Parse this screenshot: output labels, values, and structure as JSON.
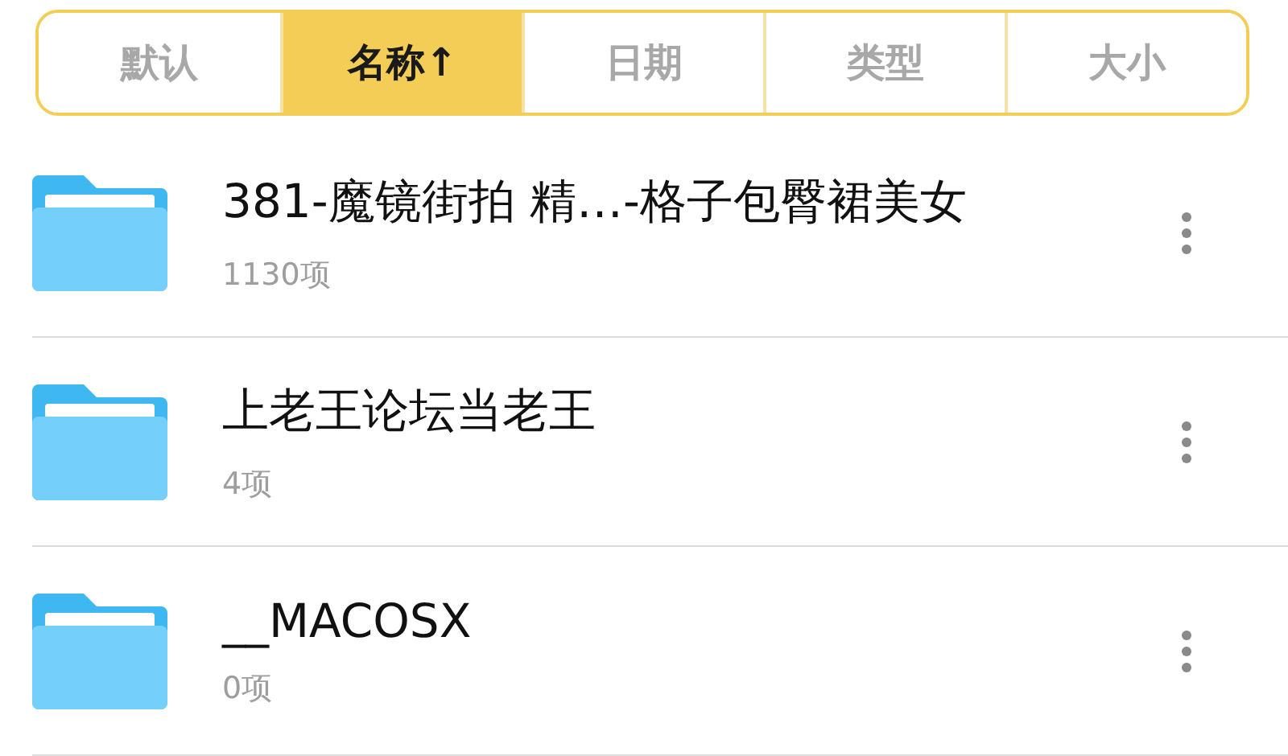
{
  "sort_tabs": [
    {
      "label": "默认",
      "selected": false
    },
    {
      "label": "名称↑",
      "selected": true
    },
    {
      "label": "日期",
      "selected": false
    },
    {
      "label": "类型",
      "selected": false
    },
    {
      "label": "大小",
      "selected": false
    }
  ],
  "files": [
    {
      "name": "381-魔镜街拍 精…-格子包臀裙美女",
      "count": "1130项"
    },
    {
      "name": "上老王论坛当老王",
      "count": "4项"
    },
    {
      "name": "__MACOSX",
      "count": "0项"
    }
  ]
}
